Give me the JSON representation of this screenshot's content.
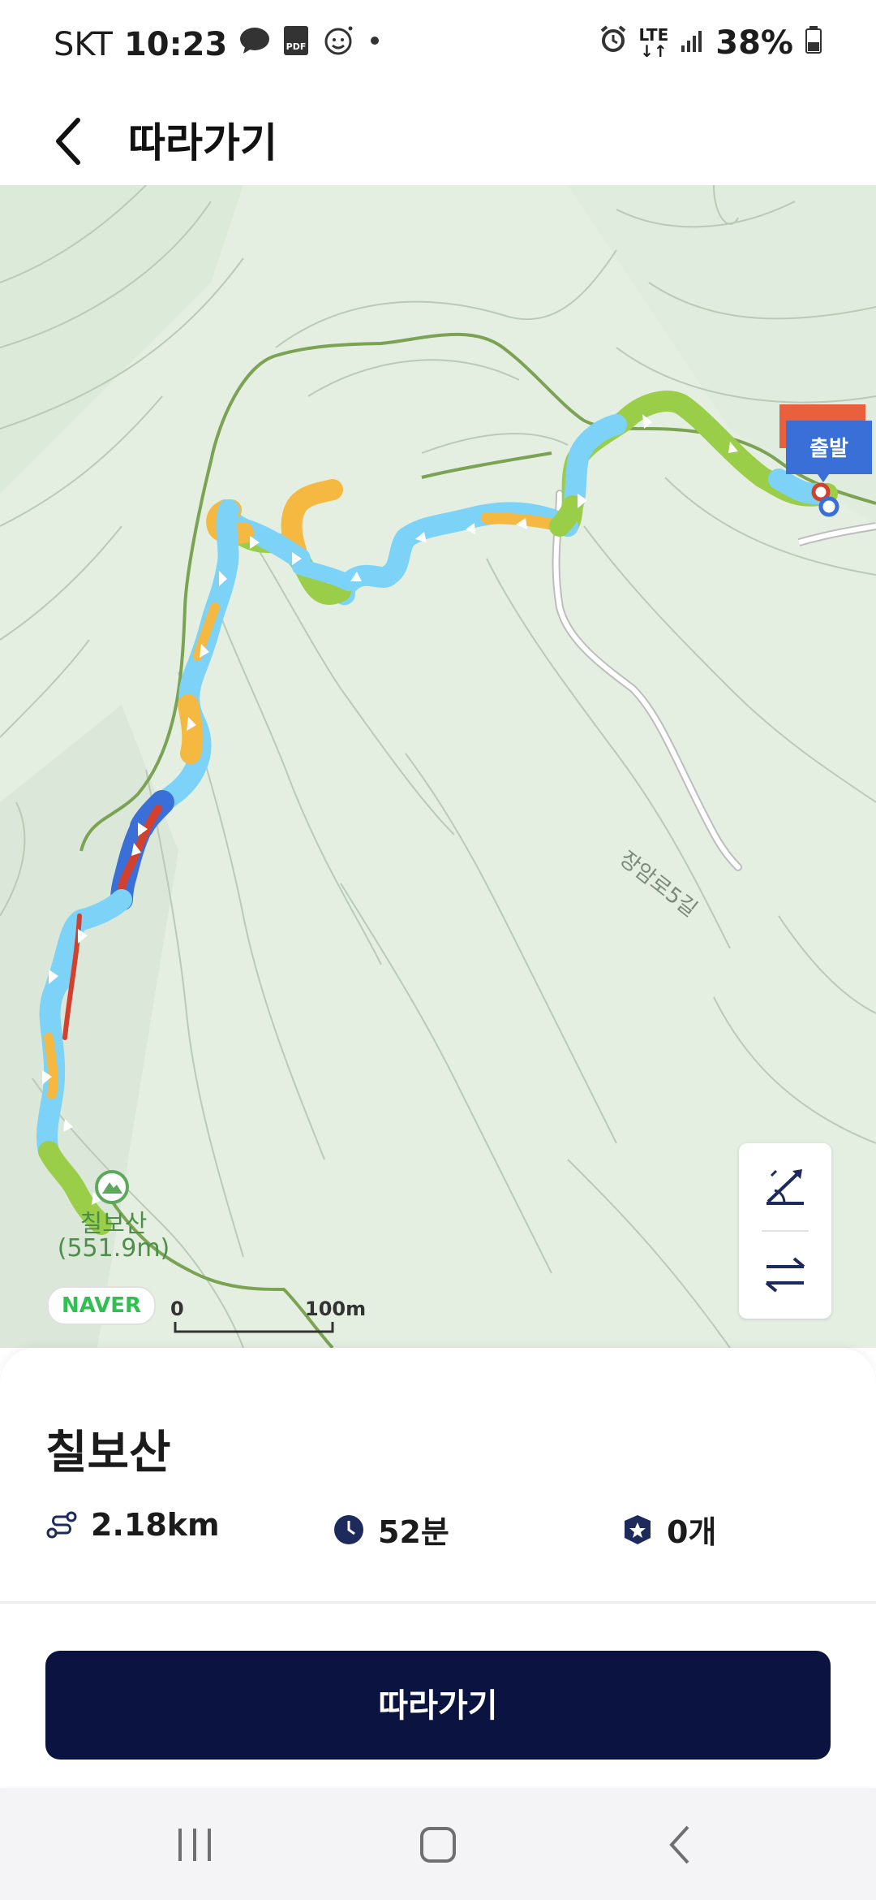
{
  "status_bar": {
    "carrier": "SKT",
    "time": "10:23",
    "network": "LTE",
    "battery": "38%"
  },
  "header": {
    "title": "따라가기"
  },
  "map": {
    "start_label": "출발",
    "peak_name": "칠보산",
    "peak_elevation": "(551.9m)",
    "road_label": "장암로5길",
    "logo": "NAVER",
    "scale_start": "0",
    "scale_end": "100m"
  },
  "route": {
    "name": "칠보산",
    "distance": "2.18km",
    "duration": "52분",
    "stamps": "0개"
  },
  "follow_button": {
    "label": "따라가기"
  },
  "colors": {
    "button": "#0b1340",
    "route_blue": "#7dd3f7",
    "route_green": "#9acd48",
    "route_orange": "#f5b840",
    "route_red": "#d2402e",
    "start_marker": "#3a6fd8",
    "peak_green": "#5da85a"
  },
  "icons": [
    "back-icon",
    "alarm-icon",
    "signal-icon",
    "battery-icon",
    "slope-icon",
    "swap-icon",
    "distance-icon",
    "clock-icon",
    "stamp-icon",
    "mountain-icon"
  ]
}
